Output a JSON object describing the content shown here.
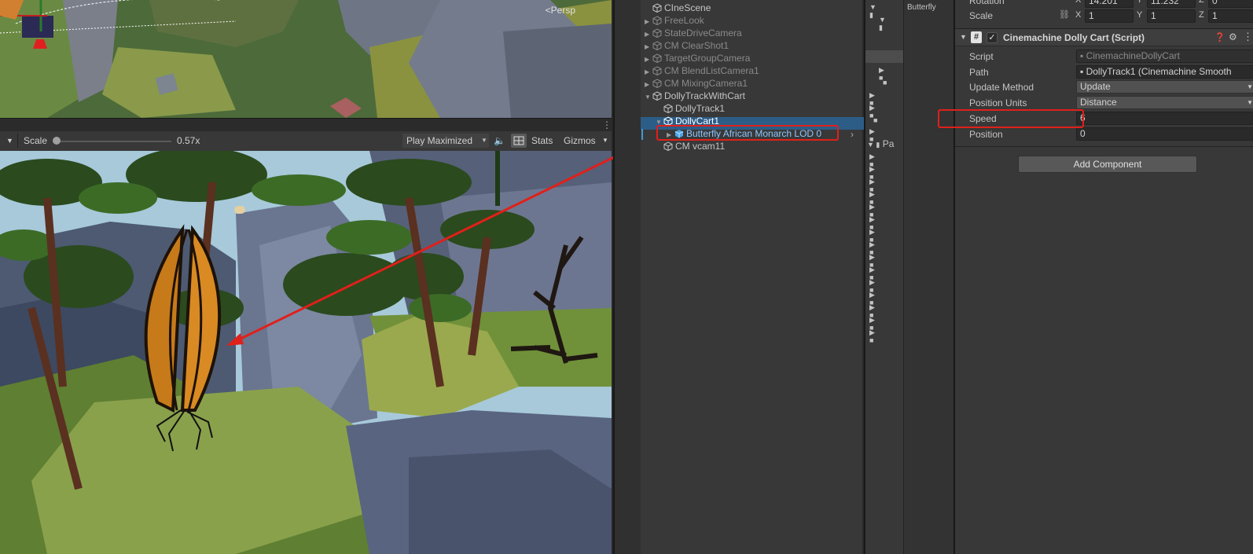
{
  "scene_view": {
    "persp_label": "<Persp"
  },
  "game_toolbar": {
    "scale_label": "Scale",
    "scale_value": "0.57x",
    "scale_fraction": 0.0,
    "play_mode": "Play Maximized",
    "stats_label": "Stats",
    "gizmos_label": "Gizmos"
  },
  "hierarchy": {
    "items": [
      {
        "label": "CIneScene",
        "dim": false
      },
      {
        "label": "FreeLook",
        "dim": true
      },
      {
        "label": "StateDriveCamera",
        "dim": true
      },
      {
        "label": "CM ClearShot1",
        "dim": true
      },
      {
        "label": "TargetGroupCamera",
        "dim": true
      },
      {
        "label": "CM BlendListCamera1",
        "dim": true
      },
      {
        "label": "CM MixingCamera1",
        "dim": true
      },
      {
        "label": "DollyTrackWithCart",
        "dim": false
      },
      {
        "label": "DollyTrack1",
        "dim": false
      },
      {
        "label": "DollyCart1",
        "dim": false,
        "selected": true
      },
      {
        "label": "Butterfly African Monarch LOD 0",
        "dim": false,
        "prefab": true
      },
      {
        "label": "CM vcam11",
        "dim": false
      }
    ]
  },
  "project": {
    "pa_label": "Pa",
    "butterfly_label": "Butterfly"
  },
  "inspector": {
    "transform": {
      "rotation_label": "Rotation",
      "rotation": {
        "x": "14.201",
        "y": "11.232",
        "z": "0"
      },
      "scale_label": "Scale",
      "scale": {
        "x": "1",
        "y": "1",
        "z": "1"
      }
    },
    "component": {
      "title": "Cinemachine Dolly Cart (Script)",
      "script_label": "Script",
      "script_value": "CinemachineDollyCart",
      "path_label": "Path",
      "path_value": "DollyTrack1 (Cinemachine Smooth",
      "update_method_label": "Update Method",
      "update_method_value": "Update",
      "position_units_label": "Position Units",
      "position_units_value": "Distance",
      "speed_label": "Speed",
      "speed_value": "6",
      "position_label": "Position",
      "position_value": "0"
    },
    "add_component_label": "Add Component"
  },
  "colors": {
    "selection": "#2c5d87",
    "annotation": "#e0201a",
    "prefab_text": "#8cc6ff"
  }
}
